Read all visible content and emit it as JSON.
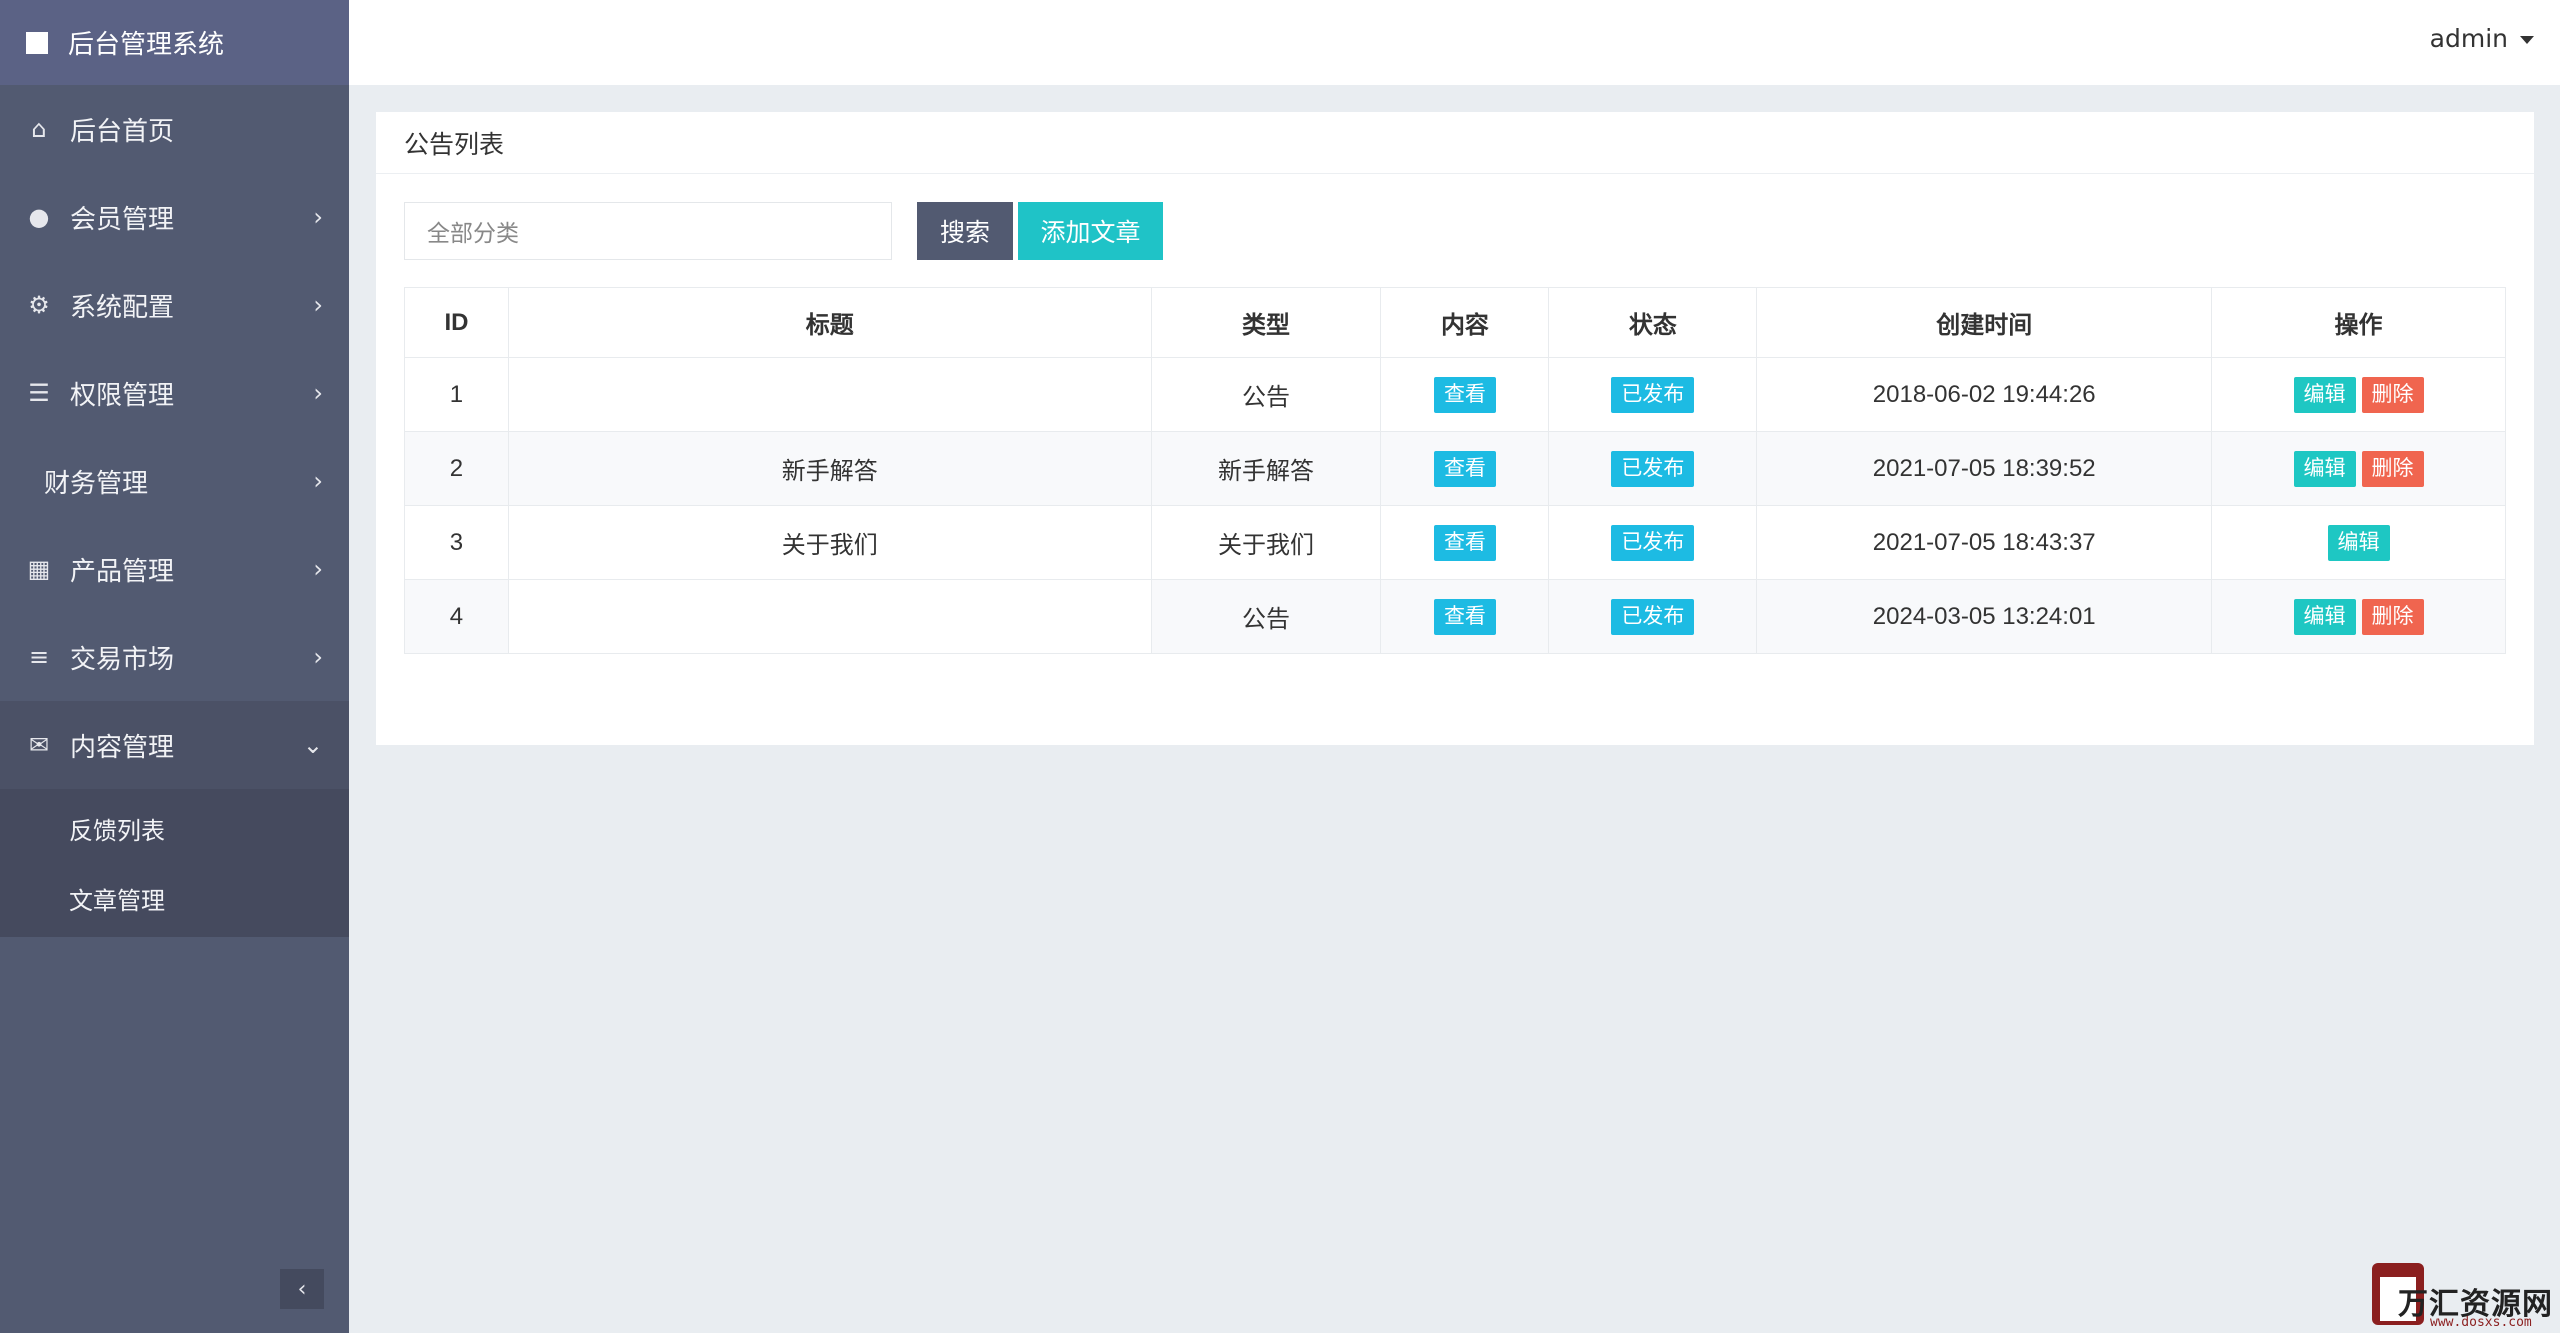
{
  "sidebar": {
    "brand": "后台管理系统",
    "items": [
      {
        "label": "后台首页",
        "icon": "home-icon"
      },
      {
        "label": "会员管理",
        "icon": "user-icon"
      },
      {
        "label": "系统配置",
        "icon": "gears-icon"
      },
      {
        "label": "权限管理",
        "icon": "server-icon"
      },
      {
        "label": "财务管理",
        "icon": ""
      },
      {
        "label": "产品管理",
        "icon": "windows-icon"
      },
      {
        "label": "交易市场",
        "icon": "bars-icon"
      },
      {
        "label": "内容管理",
        "icon": "envelope-icon"
      }
    ],
    "submenu": [
      "反馈列表",
      "文章管理"
    ],
    "collapse_glyph": "‹"
  },
  "header": {
    "user": "admin"
  },
  "panel": {
    "title": "公告列表",
    "filter_value": "全部分类",
    "search_label": "搜索",
    "add_label": "添加文章"
  },
  "table": {
    "columns": [
      "ID",
      "标题",
      "类型",
      "内容",
      "状态",
      "创建时间",
      "操作"
    ],
    "rows": [
      {
        "id": "1",
        "title": "",
        "type": "公告",
        "content": "查看",
        "status": "已发布",
        "created": "2018-06-02 19:44:26",
        "edit": "编辑",
        "del": "删除"
      },
      {
        "id": "2",
        "title": "新手解答",
        "type": "新手解答",
        "content": "查看",
        "status": "已发布",
        "created": "2021-07-05 18:39:52",
        "edit": "编辑",
        "del": "删除"
      },
      {
        "id": "3",
        "title": "关于我们",
        "type": "关于我们",
        "content": "查看",
        "status": "已发布",
        "created": "2021-07-05 18:43:37",
        "edit": "编辑",
        "del": ""
      },
      {
        "id": "4",
        "title": "",
        "type": "公告",
        "content": "查看",
        "status": "已发布",
        "created": "2024-03-05 13:24:01",
        "edit": "编辑",
        "del": "删除"
      }
    ]
  },
  "watermark": {
    "name": "万汇资源网",
    "url": "www.dosxs.com"
  },
  "colors": {
    "sidebar": "#525a71",
    "accent": "#1fc3c7",
    "info": "#1dbbe3",
    "danger": "#f0654f"
  }
}
